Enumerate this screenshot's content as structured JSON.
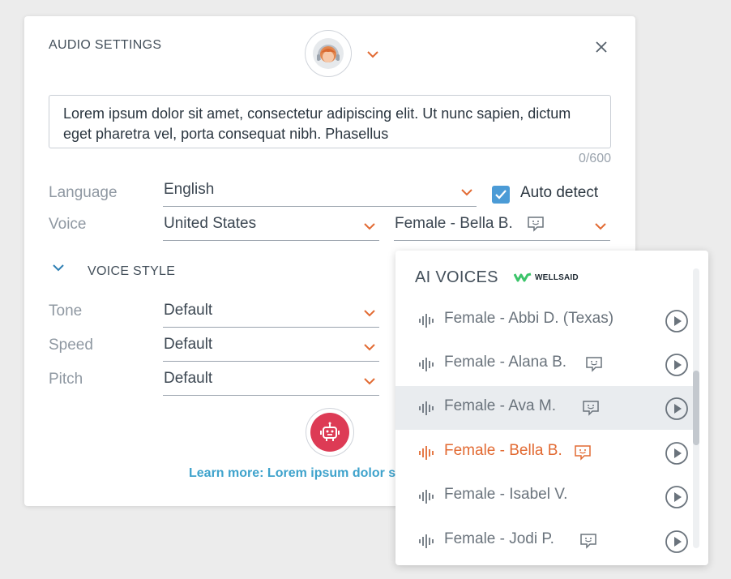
{
  "panel": {
    "title": "AUDIO SETTINGS",
    "text": "Lorem ipsum dolor sit amet, consectetur adipiscing elit. Ut nunc sapien, dictum eget pharetra vel, porta consequat nibh. Phasellus",
    "counter": "0/600"
  },
  "fields": {
    "language_label": "Language",
    "language_value": "English",
    "auto_detect_label": "Auto detect",
    "auto_detect_checked": true,
    "voice_label": "Voice",
    "voice_region": "United States",
    "voice_name": "Female - Bella B."
  },
  "voice_style": {
    "title": "VOICE STYLE",
    "tone_label": "Tone",
    "tone_value": "Default",
    "speed_label": "Speed",
    "speed_value": "Default",
    "pitch_label": "Pitch",
    "pitch_value": "Default"
  },
  "learn_more": "Learn more: Lorem ipsum dolor s",
  "dropdown": {
    "title": "AI VOICES",
    "brand": "WELLSAID",
    "items": [
      {
        "name": "Female - Abbi D. (Texas)",
        "speech": false
      },
      {
        "name": "Female - Alana B.",
        "speech": true
      },
      {
        "name": "Female - Ava M.",
        "speech": true,
        "highlighted": true
      },
      {
        "name": "Female - Bella B.",
        "speech": true,
        "selected": true
      },
      {
        "name": "Female - Isabel V.",
        "speech": false
      },
      {
        "name": "Female - Jodi P.",
        "speech": true
      }
    ]
  },
  "colors": {
    "accent_orange": "#e26a32",
    "checkbox_blue": "#4b9bd6",
    "robot_red": "#dd3b55",
    "link_blue": "#3fa3cc",
    "brand_green": "#3cc46a"
  }
}
